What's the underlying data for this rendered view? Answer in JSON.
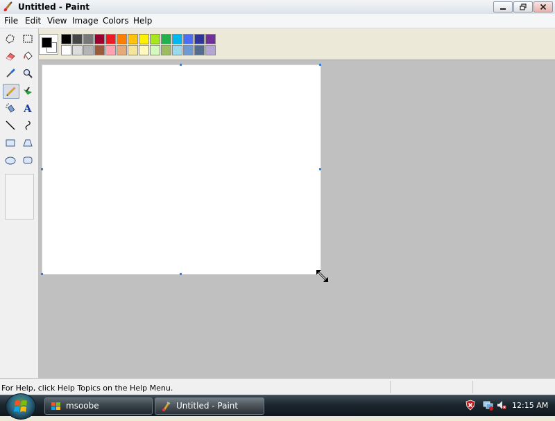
{
  "window": {
    "title": "Untitled - Paint"
  },
  "menu": [
    "File",
    "Edit",
    "View",
    "Image",
    "Colors",
    "Help"
  ],
  "tools": [
    {
      "name": "free-form-select-icon"
    },
    {
      "name": "select-icon"
    },
    {
      "name": "eraser-icon"
    },
    {
      "name": "fill-bucket-icon"
    },
    {
      "name": "color-picker-icon"
    },
    {
      "name": "magnifier-icon"
    },
    {
      "name": "pencil-icon",
      "selected": true
    },
    {
      "name": "brush-icon"
    },
    {
      "name": "airbrush-icon"
    },
    {
      "name": "text-icon",
      "glyph": "A"
    },
    {
      "name": "line-icon"
    },
    {
      "name": "curve-icon"
    },
    {
      "name": "rectangle-icon"
    },
    {
      "name": "polygon-icon"
    },
    {
      "name": "ellipse-icon"
    },
    {
      "name": "rounded-rectangle-icon"
    }
  ],
  "palette": {
    "foreground": "#000000",
    "background": "#ffffff",
    "row1": [
      "#000000",
      "#464646",
      "#787878",
      "#990030",
      "#ed1c24",
      "#ff7e00",
      "#ffc20e",
      "#fff200",
      "#a8e61d",
      "#22b14c",
      "#00b7ef",
      "#4d6df3",
      "#2f3699",
      "#6f3198"
    ],
    "row2": [
      "#ffffff",
      "#dcdcdc",
      "#b4b4b4",
      "#9c5a3c",
      "#ffa3b1",
      "#e5aa7a",
      "#f5e49c",
      "#fff9bd",
      "#d3f9bc",
      "#9dbb61",
      "#99d9ea",
      "#709ad1",
      "#546d8e",
      "#b5a5d5"
    ]
  },
  "status": {
    "help_text": "For Help, click Help Topics on the Help Menu."
  },
  "taskbar": {
    "tasks": [
      {
        "label": "msoobe",
        "icon": "windows-icon"
      },
      {
        "label": "Untitled - Paint",
        "icon": "paint-icon"
      }
    ],
    "clock": "12:15 AM"
  }
}
